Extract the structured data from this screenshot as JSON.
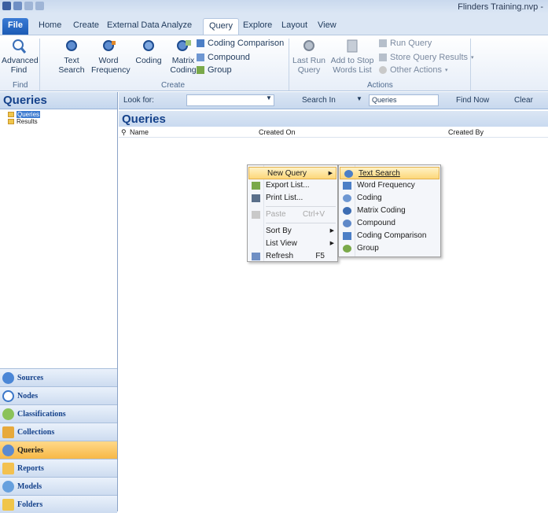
{
  "window": {
    "title": "Flinders Training.nvp -"
  },
  "tabs": [
    "File",
    "Home",
    "Create",
    "External Data",
    "Analyze",
    "Query",
    "Explore",
    "Layout",
    "View"
  ],
  "ribbon": {
    "find": {
      "advanced_find": "Advanced\nFind",
      "group": "Find"
    },
    "create": {
      "text_search": "Text\nSearch",
      "word_frequency": "Word\nFrequency",
      "coding": "Coding",
      "matrix_coding": "Matrix\nCoding",
      "coding_comparison": "Coding Comparison",
      "compound": "Compound",
      "group_item": "Group",
      "group": "Create"
    },
    "actions": {
      "last_run_query": "Last Run\nQuery",
      "add_to_stop_words": "Add to Stop\nWords List",
      "run_query": "Run Query",
      "store_query_results": "Store Query Results",
      "other_actions": "Other Actions",
      "group": "Actions"
    }
  },
  "left_pane": {
    "title": "Queries",
    "tree": [
      "Queries",
      "Results"
    ]
  },
  "nav": [
    "Sources",
    "Nodes",
    "Classifications",
    "Collections",
    "Queries",
    "Reports",
    "Models",
    "Folders"
  ],
  "search": {
    "look_for_label": "Look for:",
    "look_for_value": "",
    "search_in_label": "Search In",
    "search_in_value": "Queries",
    "find_now": "Find Now",
    "clear": "Clear"
  },
  "list": {
    "title": "Queries",
    "columns": [
      "Name",
      "Created On",
      "Created By"
    ]
  },
  "context_menu": [
    {
      "label": "New Query",
      "shortcut": "",
      "submenu": true
    },
    {
      "label": "Export List...",
      "shortcut": "",
      "submenu": false
    },
    {
      "label": "Print List...",
      "shortcut": "",
      "submenu": false
    },
    {
      "label": "Paste",
      "shortcut": "Ctrl+V",
      "submenu": false
    },
    {
      "label": "Sort By",
      "shortcut": "",
      "submenu": true
    },
    {
      "label": "List View",
      "shortcut": "",
      "submenu": true
    },
    {
      "label": "Refresh",
      "shortcut": "F5",
      "submenu": false
    }
  ],
  "submenu": [
    "Text Search",
    "Word Frequency",
    "Coding",
    "Matrix Coding",
    "Compound",
    "Coding Comparison",
    "Group"
  ],
  "colors": {
    "accent": "#15428b",
    "highlight": "#fdd77a",
    "active_nav": "#f7b846"
  }
}
